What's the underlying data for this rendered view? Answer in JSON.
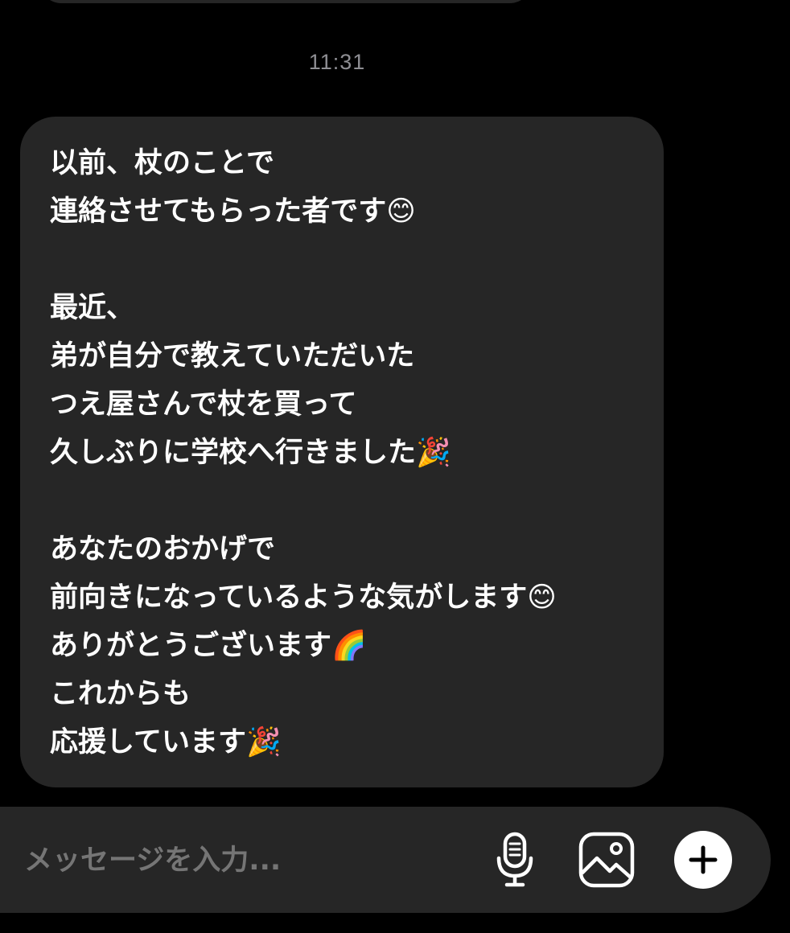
{
  "thread": {
    "timestamp": "11:31",
    "message": {
      "lines": [
        "以前、杖のことで",
        "連絡させてもらった者です😊",
        "",
        "最近、",
        "弟が自分で教えていただいた",
        "つえ屋さんで杖を買って",
        "久しぶりに学校へ行きました🎉",
        "",
        "あなたのおかげで",
        "前向きになっているような気がします😊",
        "ありがとうございます🌈",
        "これからも",
        "応援しています🎉"
      ]
    }
  },
  "composer": {
    "placeholder": "メッセージを入力...",
    "icons": {
      "mic": "microphone-icon",
      "gallery": "image-icon",
      "plus": "plus-icon"
    }
  },
  "colors": {
    "background": "#000000",
    "bubble": "#262626",
    "text": "#ffffff",
    "muted": "#8e8e93"
  }
}
